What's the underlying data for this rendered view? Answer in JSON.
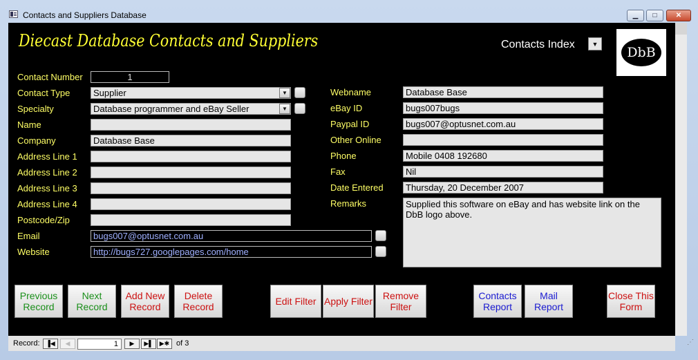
{
  "window": {
    "title": "Contacts and Suppliers Database",
    "controls": {
      "minimize": "▁",
      "maximize": "□",
      "close": "✕"
    }
  },
  "form": {
    "heading": "Diecast Database Contacts and Suppliers",
    "index_label": "Contacts Index",
    "logo_text": "DbB",
    "left_fields": [
      {
        "label": "Contact Number",
        "value": "1"
      },
      {
        "label": "Contact Type",
        "value": "Supplier"
      },
      {
        "label": "Specialty",
        "value": "Database programmer and eBay Seller"
      },
      {
        "label": "Name",
        "value": ""
      },
      {
        "label": "Company",
        "value": "Database Base"
      },
      {
        "label": "Address Line 1",
        "value": ""
      },
      {
        "label": "Address Line 2",
        "value": ""
      },
      {
        "label": "Address Line 3",
        "value": ""
      },
      {
        "label": "Address Line 4",
        "value": ""
      },
      {
        "label": "Postcode/Zip",
        "value": ""
      },
      {
        "label": "Email",
        "value": "bugs007@optusnet.com.au"
      },
      {
        "label": "Website",
        "value": "http://bugs727.googlepages.com/home"
      }
    ],
    "right_fields": [
      {
        "label": "Webname",
        "value": "Database Base"
      },
      {
        "label": "eBay ID",
        "value": "bugs007bugs"
      },
      {
        "label": "Paypal ID",
        "value": "bugs007@optusnet.com.au"
      },
      {
        "label": "Other Online",
        "value": ""
      },
      {
        "label": "Phone",
        "value": "Mobile 0408 192680"
      },
      {
        "label": "Fax",
        "value": "Nil"
      },
      {
        "label": "Date Entered",
        "value": "Thursday, 20 December 2007"
      },
      {
        "label": "Remarks",
        "value": "Supplied this software on eBay and has website link on the DbB logo above."
      }
    ],
    "buttons": {
      "previous": "Previous Record",
      "next": "Next Record",
      "add_new": "Add New Record",
      "delete": "Delete Record",
      "edit_filter": "Edit Filter",
      "apply_filter": "Apply Filter",
      "remove_filter": "Remove Filter",
      "contacts_report": "Contacts Report",
      "mail_report": "Mail Report",
      "close_form": "Close This Form"
    }
  },
  "navigation": {
    "record_label": "Record:",
    "current_record": "1",
    "of_text": "of  3",
    "buttons": {
      "first": "▐◀",
      "prev": "◀",
      "next": "▶",
      "last": "▶▌",
      "new": "▶✱"
    }
  },
  "colors": {
    "label_yellow": "#ffff66",
    "heading_yellow": "#ffff33",
    "button_green": "#1a8f1a",
    "button_red": "#cc1111",
    "button_blue": "#1a1ad0"
  },
  "icons": {
    "title_icon": "form-icon",
    "dropdown": "chevron-down-icon",
    "checkbox": "checkbox-icon"
  }
}
